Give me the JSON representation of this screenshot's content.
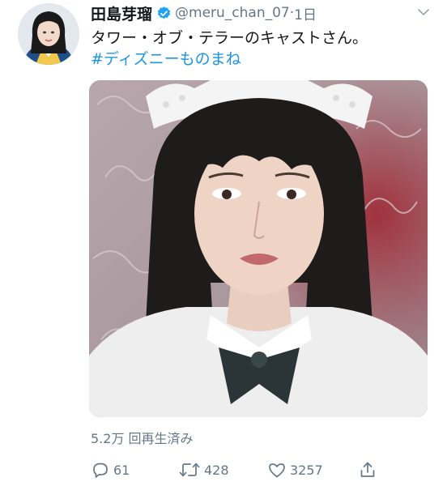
{
  "tweet": {
    "display_name": "田島芽瑠",
    "handle": "@meru_chan_07",
    "separator": "·",
    "time": "1日",
    "text": "タワー・オブ・テラーのキャストさん。",
    "hashtag": "#ディズニーものまね",
    "views": "5.2万 回再生済み"
  },
  "actions": {
    "reply_count": "61",
    "retweet_count": "428",
    "like_count": "3257"
  },
  "colors": {
    "link": "#1b95e0",
    "muted": "#657786",
    "verified": "#1da1f2"
  },
  "icons": {
    "verified": "verified-badge-icon",
    "menu": "chevron-down-icon",
    "reply": "reply-icon",
    "retweet": "retweet-icon",
    "like": "heart-icon",
    "share": "share-icon"
  }
}
